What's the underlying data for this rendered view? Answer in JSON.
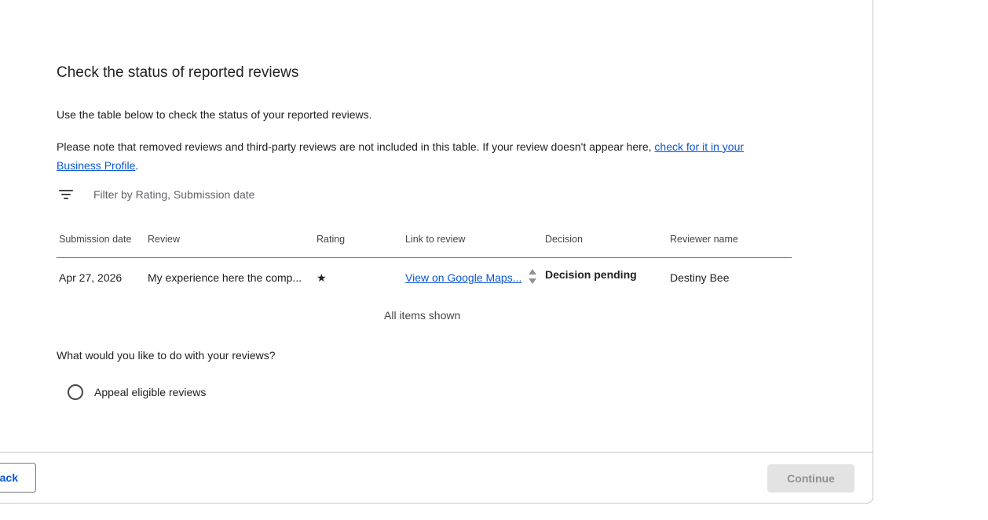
{
  "header": {
    "title": "Check the status of reported reviews",
    "intro": "Use the table below to check the status of your reported reviews.",
    "note_prefix": "Please note that removed reviews and third-party reviews are not included in this table. If your review doesn't appear here, ",
    "note_link": "check for it in your Business Profile",
    "note_suffix": "."
  },
  "filter": {
    "icon": "filter-list-icon",
    "label": "Filter by Rating, Submission date"
  },
  "table": {
    "columns": [
      "Submission date",
      "Review",
      "Rating",
      "Link to review",
      "Decision",
      "Reviewer name"
    ],
    "rows": [
      {
        "submission_date": "Apr 27, 2026",
        "review": "My experience here the comp...",
        "rating": "★",
        "link": "View on Google Maps...",
        "decision": "Decision pending",
        "reviewer": "Destiny Bee"
      }
    ],
    "footer": "All items shown"
  },
  "actions": {
    "question": "What would you like to do with your reviews?",
    "option": "Appeal eligible reviews"
  },
  "footer": {
    "back_label": "ack",
    "continue_label": "Continue"
  },
  "colors": {
    "link": "#0b57d0",
    "disabled_button_bg": "#e3e3e3",
    "border": "#c4c7c5"
  }
}
